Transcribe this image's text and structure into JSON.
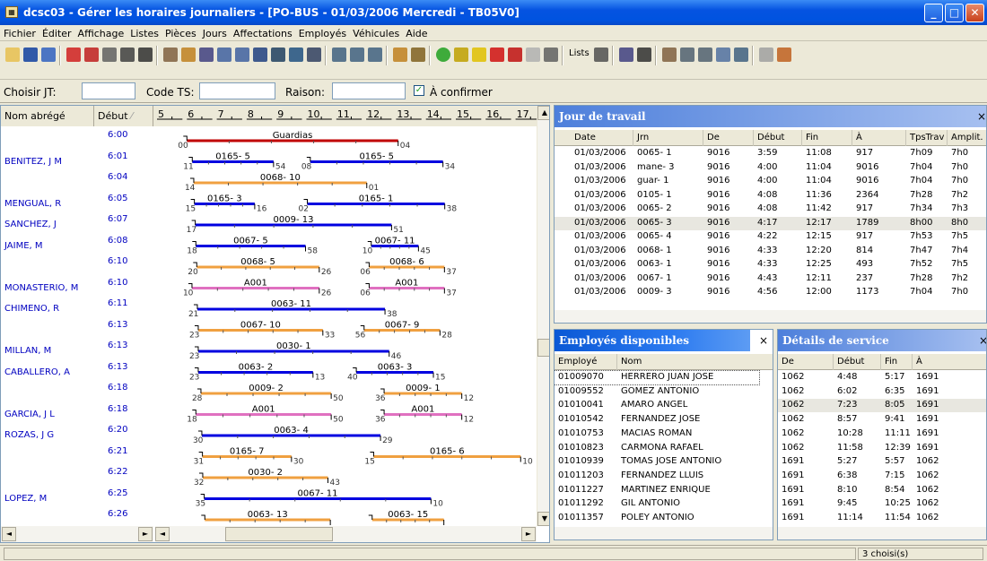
{
  "window": {
    "title": "dcsc03 - Gérer les horaires journaliers - [PO-BUS - 01/03/2006 Mercredi - TB05V0]"
  },
  "menu": [
    "Fichier",
    "Éditer",
    "Affichage",
    "Listes",
    "Pièces",
    "Jours",
    "Affectations",
    "Employés",
    "Véhicules",
    "Aide"
  ],
  "toolbar": {
    "lists_label": "Lists"
  },
  "filters": {
    "choisir_jt": "Choisir JT:",
    "code_ts": "Code TS:",
    "raison": "Raison:",
    "a_confirmer": "À confirmer"
  },
  "schedule": {
    "col_name": "Nom abrégé",
    "col_start": "Début",
    "hours": [
      "5",
      "6",
      "7",
      "8",
      "9",
      "10",
      "11",
      "12",
      "13",
      "14",
      "15",
      "16",
      "17"
    ],
    "rows": [
      {
        "name": "",
        "start": "6:00"
      },
      {
        "name": "BENITEZ, J M",
        "start": "6:01"
      },
      {
        "name": "",
        "start": "6:04"
      },
      {
        "name": "MENGUAL, R",
        "start": "6:05"
      },
      {
        "name": "SANCHEZ, J",
        "start": "6:07"
      },
      {
        "name": "JAIME, M",
        "start": "6:08"
      },
      {
        "name": "",
        "start": "6:10"
      },
      {
        "name": "MONASTERIO, M",
        "start": "6:10"
      },
      {
        "name": "CHIMENO, R",
        "start": "6:11"
      },
      {
        "name": "",
        "start": "6:13"
      },
      {
        "name": "MILLAN, M",
        "start": "6:13"
      },
      {
        "name": "CABALLERO, A",
        "start": "6:13"
      },
      {
        "name": "",
        "start": "6:18"
      },
      {
        "name": "GARCIA, J L",
        "start": "6:18"
      },
      {
        "name": "ROZAS, J G",
        "start": "6:20"
      },
      {
        "name": "",
        "start": "6:21"
      },
      {
        "name": "",
        "start": "6:22"
      },
      {
        "name": "LOPEZ, M",
        "start": "6:25"
      },
      {
        "name": "",
        "start": "6:26"
      }
    ],
    "bars": [
      {
        "row": 0,
        "start": 6.0,
        "end": 13.07,
        "color": "#c00000",
        "label": "Guardias",
        "sl": "00",
        "el": "04"
      },
      {
        "row": 1,
        "start": 6.18,
        "end": 8.9,
        "color": "#0000e0",
        "label": "0165- 5",
        "sl": "11",
        "el": "54"
      },
      {
        "row": 1,
        "start": 10.13,
        "end": 14.57,
        "color": "#0000e0",
        "label": "0165- 5",
        "sl": "08",
        "el": "34"
      },
      {
        "row": 2,
        "start": 6.23,
        "end": 12.02,
        "color": "#f0a040",
        "label": "0068- 10",
        "sl": "14",
        "el": "01"
      },
      {
        "row": 3,
        "start": 6.25,
        "end": 8.27,
        "color": "#0000e0",
        "label": "0165- 3",
        "sl": "15",
        "el": "16"
      },
      {
        "row": 3,
        "start": 10.03,
        "end": 14.63,
        "color": "#0000e0",
        "label": "0165- 1",
        "sl": "02",
        "el": "38"
      },
      {
        "row": 4,
        "start": 6.28,
        "end": 12.85,
        "color": "#0000e0",
        "label": "0009- 13",
        "sl": "17",
        "el": "51"
      },
      {
        "row": 5,
        "start": 6.3,
        "end": 9.97,
        "color": "#0000e0",
        "label": "0067- 5",
        "sl": "18",
        "el": "58"
      },
      {
        "row": 5,
        "start": 12.17,
        "end": 13.75,
        "color": "#0000e0",
        "label": "0067- 11",
        "sl": "10",
        "el": "45"
      },
      {
        "row": 6,
        "start": 6.33,
        "end": 10.43,
        "color": "#f0a040",
        "label": "0068- 5",
        "sl": "20",
        "el": "26"
      },
      {
        "row": 6,
        "start": 12.1,
        "end": 14.62,
        "color": "#f0a040",
        "label": "0068- 6",
        "sl": "06",
        "el": "37"
      },
      {
        "row": 7,
        "start": 6.17,
        "end": 10.43,
        "color": "#e070c0",
        "label": "A001",
        "sl": "10",
        "el": "26"
      },
      {
        "row": 7,
        "start": 12.1,
        "end": 14.62,
        "color": "#e070c0",
        "label": "A001",
        "sl": "06",
        "el": "37"
      },
      {
        "row": 8,
        "start": 6.35,
        "end": 12.63,
        "color": "#0000e0",
        "label": "0063- 11",
        "sl": "21",
        "el": "38"
      },
      {
        "row": 9,
        "start": 6.38,
        "end": 10.55,
        "color": "#f0a040",
        "label": "0067- 10",
        "sl": "23",
        "el": "33"
      },
      {
        "row": 9,
        "start": 11.93,
        "end": 14.47,
        "color": "#f0a040",
        "label": "0067- 9",
        "sl": "56",
        "el": "28"
      },
      {
        "row": 10,
        "start": 6.38,
        "end": 12.77,
        "color": "#0000e0",
        "label": "0030- 1",
        "sl": "23",
        "el": "46"
      },
      {
        "row": 11,
        "start": 6.38,
        "end": 10.22,
        "color": "#0000e0",
        "label": "0063- 2",
        "sl": "23",
        "el": "13"
      },
      {
        "row": 11,
        "start": 11.67,
        "end": 14.25,
        "color": "#0000e0",
        "label": "0063- 3",
        "sl": "40",
        "el": "15"
      },
      {
        "row": 12,
        "start": 6.47,
        "end": 10.83,
        "color": "#f0a040",
        "label": "0009- 2",
        "sl": "28",
        "el": "50"
      },
      {
        "row": 12,
        "start": 12.6,
        "end": 15.2,
        "color": "#f0a040",
        "label": "0009- 1",
        "sl": "36",
        "el": "12"
      },
      {
        "row": 13,
        "start": 6.3,
        "end": 10.83,
        "color": "#e070c0",
        "label": "A001",
        "sl": "18",
        "el": "50"
      },
      {
        "row": 13,
        "start": 12.6,
        "end": 15.2,
        "color": "#e070c0",
        "label": "A001",
        "sl": "36",
        "el": "12"
      },
      {
        "row": 14,
        "start": 6.5,
        "end": 12.48,
        "color": "#0000e0",
        "label": "0063- 4",
        "sl": "30",
        "el": "29"
      },
      {
        "row": 15,
        "start": 6.52,
        "end": 9.5,
        "color": "#f0a040",
        "label": "0165- 7",
        "sl": "31",
        "el": "30"
      },
      {
        "row": 15,
        "start": 12.25,
        "end": 17.17,
        "color": "#f0a040",
        "label": "0165- 6",
        "sl": "15",
        "el": "10"
      },
      {
        "row": 16,
        "start": 6.53,
        "end": 10.72,
        "color": "#f0a040",
        "label": "0030- 2",
        "sl": "32",
        "el": "43"
      },
      {
        "row": 17,
        "start": 6.58,
        "end": 14.17,
        "color": "#0000e0",
        "label": "0067- 11",
        "sl": "35",
        "el": "10"
      },
      {
        "row": 18,
        "start": 6.6,
        "end": 10.8,
        "color": "#f0a040",
        "label": "0063- 13",
        "sl": "",
        "el": ""
      },
      {
        "row": 18,
        "start": 12.2,
        "end": 14.6,
        "color": "#f0a040",
        "label": "0063- 15",
        "sl": "",
        "el": ""
      }
    ]
  },
  "jour_travail": {
    "title": "Jour de travail",
    "columns": [
      "Date",
      "Jrn",
      "De",
      "Début",
      "Fin",
      "À",
      "TpsTrav",
      "Amplit."
    ],
    "rows": [
      [
        "01/03/2006",
        "0065- 1",
        "9016",
        "3:59",
        "11:08",
        "917",
        "7h09",
        "7h0"
      ],
      [
        "01/03/2006",
        "mane- 3",
        "9016",
        "4:00",
        "11:04",
        "9016",
        "7h04",
        "7h0"
      ],
      [
        "01/03/2006",
        "guar- 1",
        "9016",
        "4:00",
        "11:04",
        "9016",
        "7h04",
        "7h0"
      ],
      [
        "01/03/2006",
        "0105- 1",
        "9016",
        "4:08",
        "11:36",
        "2364",
        "7h28",
        "7h2"
      ],
      [
        "01/03/2006",
        "0065- 2",
        "9016",
        "4:08",
        "11:42",
        "917",
        "7h34",
        "7h3"
      ],
      [
        "01/03/2006",
        "0065- 3",
        "9016",
        "4:17",
        "12:17",
        "1789",
        "8h00",
        "8h0"
      ],
      [
        "01/03/2006",
        "0065- 4",
        "9016",
        "4:22",
        "12:15",
        "917",
        "7h53",
        "7h5"
      ],
      [
        "01/03/2006",
        "0068- 1",
        "9016",
        "4:33",
        "12:20",
        "814",
        "7h47",
        "7h4"
      ],
      [
        "01/03/2006",
        "0063- 1",
        "9016",
        "4:33",
        "12:25",
        "493",
        "7h52",
        "7h5"
      ],
      [
        "01/03/2006",
        "0067- 1",
        "9016",
        "4:43",
        "12:11",
        "237",
        "7h28",
        "7h2"
      ],
      [
        "01/03/2006",
        "0009- 3",
        "9016",
        "4:56",
        "12:00",
        "1173",
        "7h04",
        "7h0"
      ]
    ]
  },
  "employes": {
    "title": "Employés disponibles",
    "columns": [
      "Employé",
      "Nom"
    ],
    "rows": [
      [
        "01009070",
        "HERRERO JUAN JOSE"
      ],
      [
        "01009552",
        "GOMEZ ANTONIO"
      ],
      [
        "01010041",
        "AMARO ANGEL"
      ],
      [
        "01010542",
        "FERNANDEZ JOSE"
      ],
      [
        "01010753",
        "MACIAS ROMAN"
      ],
      [
        "01010823",
        "CARMONA RAFAEL"
      ],
      [
        "01010939",
        "TOMAS JOSE ANTONIO"
      ],
      [
        "01011203",
        "FERNANDEZ LLUIS"
      ],
      [
        "01011227",
        "MARTINEZ ENRIQUE"
      ],
      [
        "01011292",
        "GIL ANTONIO"
      ],
      [
        "01011357",
        "POLEY ANTONIO"
      ]
    ]
  },
  "details": {
    "title": "Détails de service",
    "columns": [
      "De",
      "Début",
      "Fin",
      "À"
    ],
    "rows": [
      [
        "1062",
        "4:48",
        "5:17",
        "1691"
      ],
      [
        "1062",
        "6:02",
        "6:35",
        "1691"
      ],
      [
        "1062",
        "7:23",
        "8:05",
        "1691"
      ],
      [
        "1062",
        "8:57",
        "9:41",
        "1691"
      ],
      [
        "1062",
        "10:28",
        "11:11",
        "1691"
      ],
      [
        "1062",
        "11:58",
        "12:39",
        "1691"
      ],
      [
        "1691",
        "5:27",
        "5:57",
        "1062"
      ],
      [
        "1691",
        "6:38",
        "7:15",
        "1062"
      ],
      [
        "1691",
        "8:10",
        "8:54",
        "1062"
      ],
      [
        "1691",
        "9:45",
        "10:25",
        "1062"
      ],
      [
        "1691",
        "11:14",
        "11:54",
        "1062"
      ]
    ]
  },
  "status": {
    "selected": "3 choisi(s)"
  },
  "close_glyph": "×"
}
